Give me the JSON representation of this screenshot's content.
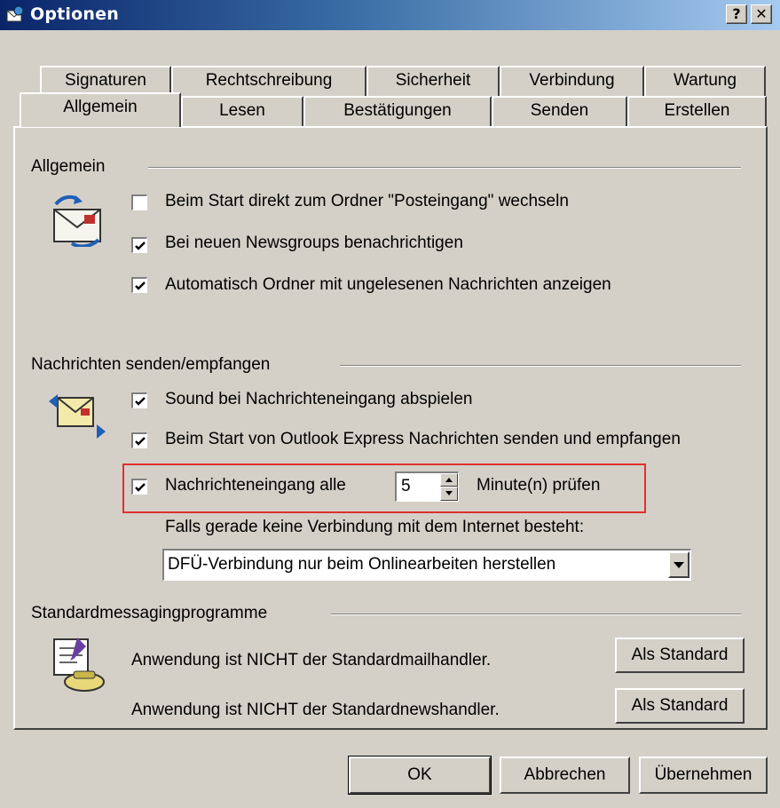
{
  "window": {
    "title": "Optionen",
    "help_button": "?",
    "close_button": "✕"
  },
  "tabs_row1": [
    "Signaturen",
    "Rechtschreibung",
    "Sicherheit",
    "Verbindung",
    "Wartung"
  ],
  "tabs_row2": [
    "Allgemein",
    "Lesen",
    "Bestätigungen",
    "Senden",
    "Erstellen"
  ],
  "active_tab": "Allgemein",
  "allgemein": {
    "heading": "Allgemein",
    "options": [
      {
        "label": "Beim Start direkt zum Ordner \"Posteingang\" wechseln",
        "checked": false
      },
      {
        "label": "Bei neuen Newsgroups benachrichtigen",
        "checked": true
      },
      {
        "label": "Automatisch Ordner mit ungelesenen Nachrichten anzeigen",
        "checked": true
      }
    ]
  },
  "send_receive": {
    "heading": "Nachrichten senden/empfangen",
    "options": [
      {
        "label": "Sound bei Nachrichteneingang abspielen",
        "checked": true
      },
      {
        "label": "Beim Start von Outlook Express Nachrichten senden und empfangen",
        "checked": true
      }
    ],
    "check_interval": {
      "label_before": "Nachrichteneingang alle",
      "value": "5",
      "label_after": "Minute(n) prüfen",
      "checked": true
    },
    "no_connection_label": "Falls gerade keine Verbindung mit dem Internet besteht:",
    "connection_select": "DFÜ-Verbindung nur beim Onlinearbeiten herstellen"
  },
  "default_programs": {
    "heading": "Standardmessagingprogramme",
    "mail_text": "Anwendung ist NICHT der Standardmailhandler.",
    "news_text": "Anwendung ist NICHT der Standardnewshandler.",
    "set_default_label": "Als Standard"
  },
  "footer": {
    "ok": "OK",
    "cancel": "Abbrechen",
    "apply": "Übernehmen"
  },
  "colors": {
    "highlight_box": "#e03030",
    "title_bar": "#0a246a"
  }
}
